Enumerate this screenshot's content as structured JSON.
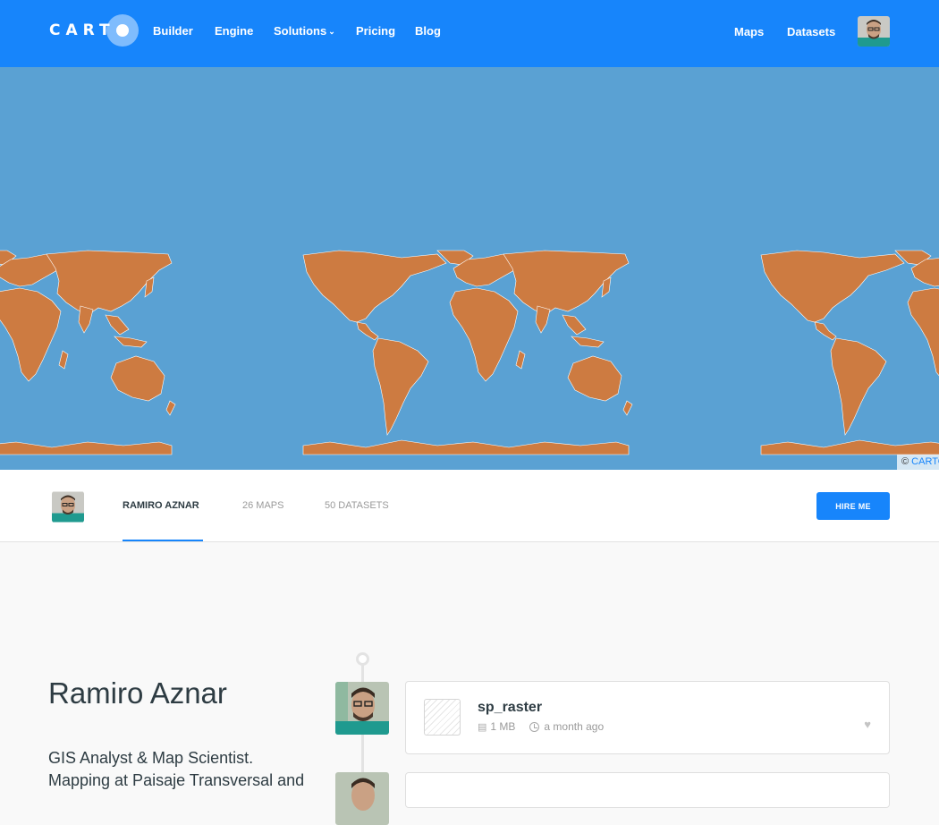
{
  "nav": {
    "logo": "CART",
    "links": [
      "Builder",
      "Engine",
      "Solutions",
      "Pricing",
      "Blog"
    ],
    "right_links": [
      "Maps",
      "Datasets"
    ]
  },
  "map": {
    "attribution_symbol": "©",
    "attribution_link": "CARTO",
    "water_color": "#5aa1d3",
    "land_color": "#cd7b41"
  },
  "profile": {
    "username": "RAMIRO AZNAR",
    "maps_tab": "26 MAPS",
    "datasets_tab": "50 DATASETS",
    "hire_button": "HIRE ME"
  },
  "user": {
    "name": "Ramiro Aznar",
    "bio": "GIS Analyst & Map Scientist. Mapping at Paisaje Transversal and"
  },
  "items": [
    {
      "title": "sp_raster",
      "size": "1 MB",
      "time": "a month ago"
    }
  ]
}
